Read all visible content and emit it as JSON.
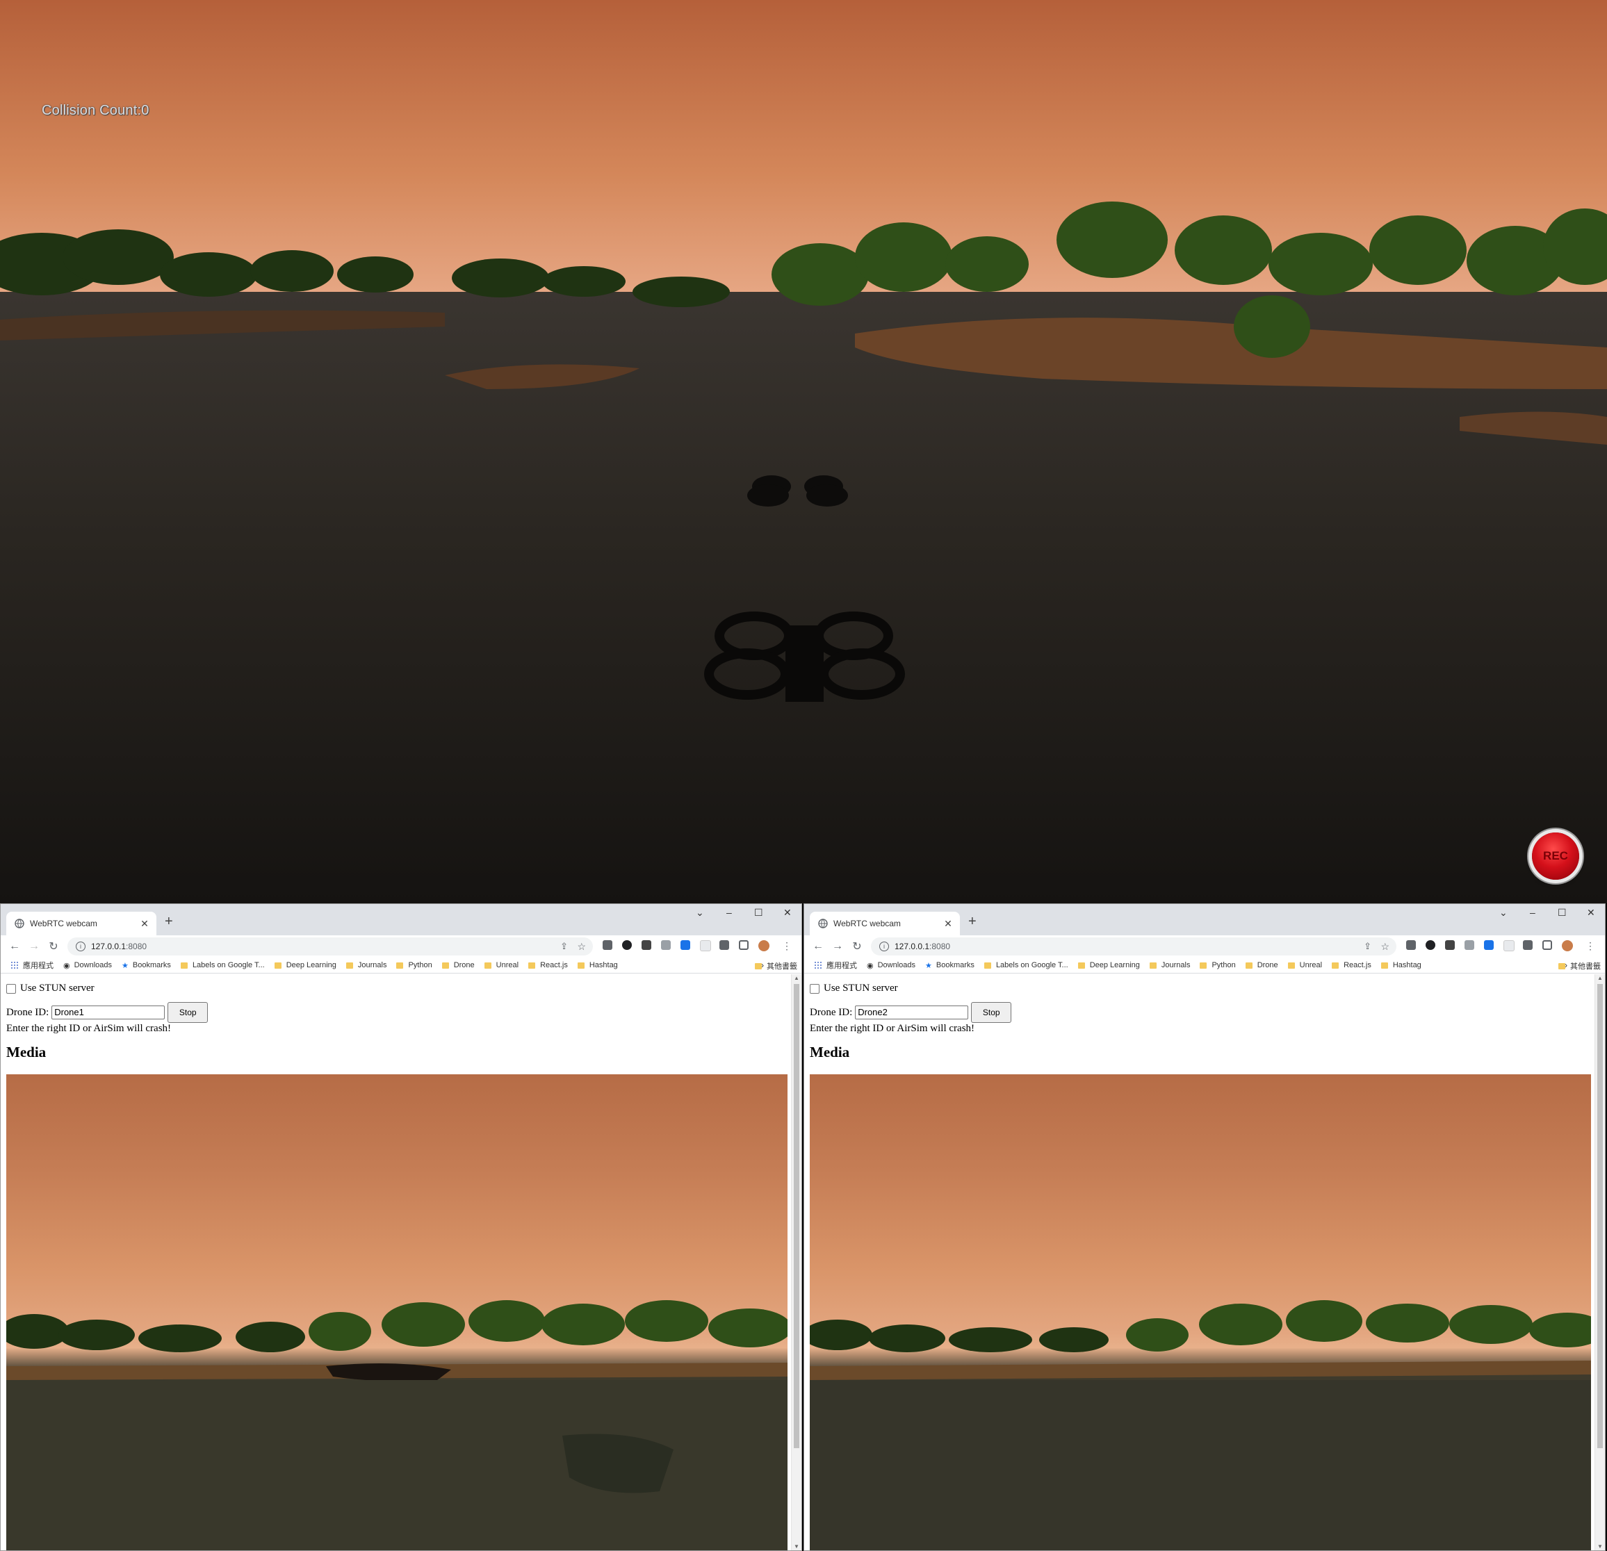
{
  "sim": {
    "collision_label": "Collision Count:0",
    "rec_label": "REC"
  },
  "windows": [
    {
      "tab_title": "WebRTC webcam",
      "url_host": "127.0.0.1",
      "url_port": ":8080",
      "bookmarks": [
        "應用程式",
        "Downloads",
        "Bookmarks",
        "Labels on Google T...",
        "Deep Learning",
        "Journals",
        "Python",
        "Drone",
        "Unreal",
        "React.js",
        "Hashtag"
      ],
      "bookmarks_more": "»",
      "bookmarks_other": "其他書籤",
      "stun_label": "Use STUN server",
      "drone_id_label": "Drone ID:",
      "drone_id_value": "Drone1",
      "stop_label": "Stop",
      "warning": "Enter the right ID or AirSim will crash!",
      "media_heading": "Media"
    },
    {
      "tab_title": "WebRTC webcam",
      "url_host": "127.0.0.1",
      "url_port": ":8080",
      "bookmarks": [
        "應用程式",
        "Downloads",
        "Bookmarks",
        "Labels on Google T...",
        "Deep Learning",
        "Journals",
        "Python",
        "Drone",
        "Unreal",
        "React.js",
        "Hashtag"
      ],
      "bookmarks_more": "»",
      "bookmarks_other": "其他書籤",
      "stun_label": "Use STUN server",
      "drone_id_label": "Drone ID:",
      "drone_id_value": "Drone2",
      "stop_label": "Stop",
      "warning": "Enter the right ID or AirSim will crash!",
      "media_heading": "Media"
    }
  ]
}
